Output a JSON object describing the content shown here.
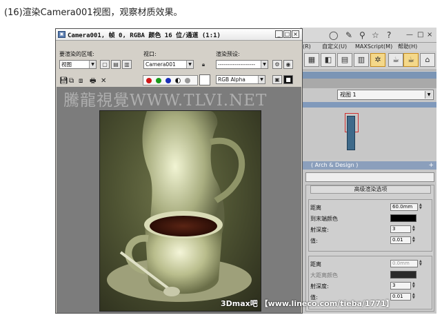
{
  "caption": "(16)渲染Camera001视图，观察材质效果。",
  "frame_window": {
    "title": "Camera001, 帧 0, RGBA 颜色 16 位/通道 (1:1)",
    "min_btn": "_",
    "max_btn": "□",
    "close_btn": "×",
    "area_label": "要渲染的区域:",
    "area_value": "视图",
    "viewport_label": "视口:",
    "viewport_value": "Camera001",
    "preset_label": "渲染预设:",
    "preset_value": "--------------------",
    "channel_value": "RGB Alpha",
    "watermark": "騰龍視覺WWW.TLVI.NET",
    "credit": "3Dmax吧 【www.lineco.com/tieba/1771】",
    "colors": {
      "red": "#d01818",
      "green": "#1a9a1a",
      "blue": "#1a2fb8"
    }
  },
  "max_panel": {
    "toolbar_icons": [
      "binoculars-icon",
      "wrench-icon",
      "star-icon",
      "help-icon"
    ],
    "menu": [
      "(R)",
      "自定义(U)",
      "MAXScript(M)",
      "帮助(H)"
    ],
    "view_select": "视图 1",
    "group_title": "( Arch & Design )",
    "subpanel_title": "高级渲染选项",
    "params_a": [
      {
        "label": "距离",
        "value": "60.0mm"
      },
      {
        "label": "到末端颜色",
        "value": ""
      },
      {
        "label": "射深度:",
        "value": "3"
      },
      {
        "label": "值:",
        "value": "0.01"
      }
    ],
    "params_b": [
      {
        "label": "距离",
        "value": "0.0mm"
      },
      {
        "label": "大距离颜色",
        "value": ""
      },
      {
        "label": "射深度:",
        "value": "3"
      },
      {
        "label": "值:",
        "value": "0.01"
      }
    ]
  }
}
